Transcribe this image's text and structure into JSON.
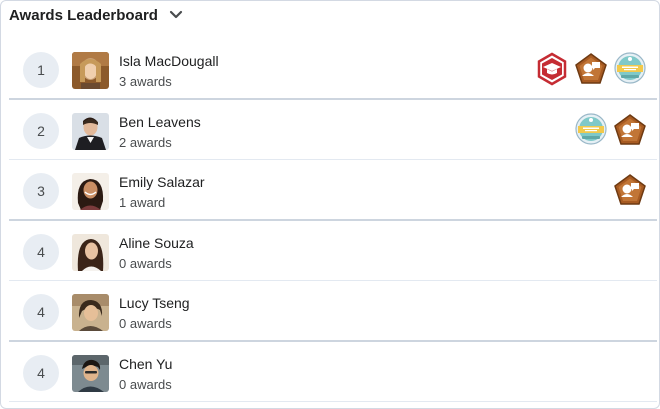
{
  "widget": {
    "title": "Awards Leaderboard",
    "toggle_icon": "chevron-down-icon"
  },
  "rows": [
    {
      "rank": "1",
      "name": "Isla MacDougall",
      "awards": "3 awards",
      "badges": [
        "graduation-cap-badge",
        "speech-pentagon-badge",
        "certificate-ribbon-badge"
      ]
    },
    {
      "rank": "2",
      "name": "Ben Leavens",
      "awards": "2 awards",
      "badges": [
        "certificate-ribbon-badge",
        "speech-pentagon-badge"
      ]
    },
    {
      "rank": "3",
      "name": "Emily Salazar",
      "awards": "1 award",
      "badges": [
        "speech-pentagon-badge"
      ]
    },
    {
      "rank": "4",
      "name": "Aline Souza",
      "awards": "0 awards",
      "badges": []
    },
    {
      "rank": "4",
      "name": "Lucy Tseng",
      "awards": "0 awards",
      "badges": []
    },
    {
      "rank": "4",
      "name": "Chen Yu",
      "awards": "0 awards",
      "badges": []
    }
  ],
  "colors": {
    "rank_bg": "#e8edf3",
    "badge_red": "#c52c33",
    "badge_bronze": "#a85b22",
    "badge_teal": "#7fc9c9"
  }
}
